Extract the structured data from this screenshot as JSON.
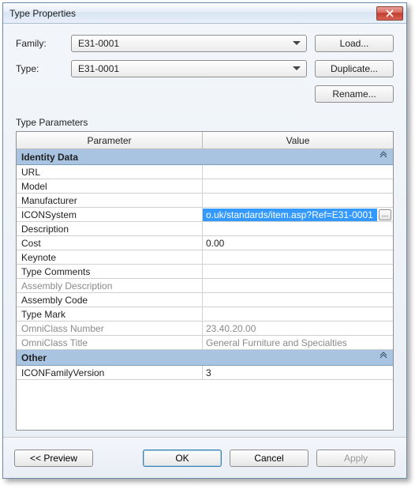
{
  "title": "Type Properties",
  "family_label": "Family:",
  "type_label": "Type:",
  "family_value": "E31-0001",
  "type_value": "E31-0001",
  "buttons": {
    "load": "Load...",
    "duplicate": "Duplicate...",
    "rename": "Rename...",
    "preview": "<< Preview",
    "ok": "OK",
    "cancel": "Cancel",
    "apply": "Apply"
  },
  "section_label": "Type Parameters",
  "columns": {
    "param": "Parameter",
    "value": "Value"
  },
  "groups": {
    "identity": {
      "label": "Identity Data",
      "rows": {
        "url": {
          "name": "URL",
          "value": ""
        },
        "model": {
          "name": "Model",
          "value": ""
        },
        "manufacturer": {
          "name": "Manufacturer",
          "value": ""
        },
        "iconsystem": {
          "name": "ICONSystem",
          "value": "o.uk/standards/item.asp?Ref=E31-0001"
        },
        "description": {
          "name": "Description",
          "value": ""
        },
        "cost": {
          "name": "Cost",
          "value": "0.00"
        },
        "keynote": {
          "name": "Keynote",
          "value": ""
        },
        "typecomments": {
          "name": "Type Comments",
          "value": ""
        },
        "assemblydesc": {
          "name": "Assembly Description",
          "value": ""
        },
        "assemblycode": {
          "name": "Assembly Code",
          "value": ""
        },
        "typemark": {
          "name": "Type Mark",
          "value": ""
        },
        "omninum": {
          "name": "OmniClass Number",
          "value": "23.40.20.00"
        },
        "omnititle": {
          "name": "OmniClass Title",
          "value": "General Furniture and Specialties"
        }
      }
    },
    "other": {
      "label": "Other",
      "rows": {
        "iconfamver": {
          "name": "ICONFamilyVersion",
          "value": "3"
        }
      }
    }
  }
}
